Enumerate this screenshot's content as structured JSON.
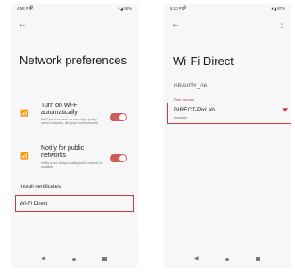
{
  "left_screen": {
    "status": {
      "time": "4:58 PM",
      "right": "▾◢ 94%"
    },
    "title": "Network preferences",
    "preferences": [
      {
        "title": "Turn on Wi-Fi automatically",
        "description": "Wi-Fi will turn back on near high-quality saved networks, like your home network",
        "enabled": true,
        "icon": "wifi-auto-icon"
      },
      {
        "title": "Notify for public networks",
        "description": "Notify when a high-quality public network is available",
        "enabled": true,
        "icon": "wifi-notify-icon"
      }
    ],
    "install_certificates": "Install certificates",
    "wifi_direct": "Wi-Fi Direct"
  },
  "right_screen": {
    "status": {
      "time": "5:10 PM",
      "right": "▾◢ 87%"
    },
    "title": "Wi-Fi Direct",
    "device_name": "GRAVITY_G6",
    "section_label": "Peer devices",
    "peer": {
      "name": "DIRECT-PixLab",
      "status": "Available"
    }
  },
  "colors": {
    "accent": "#cf5b5b",
    "highlight": "#d6373b"
  }
}
